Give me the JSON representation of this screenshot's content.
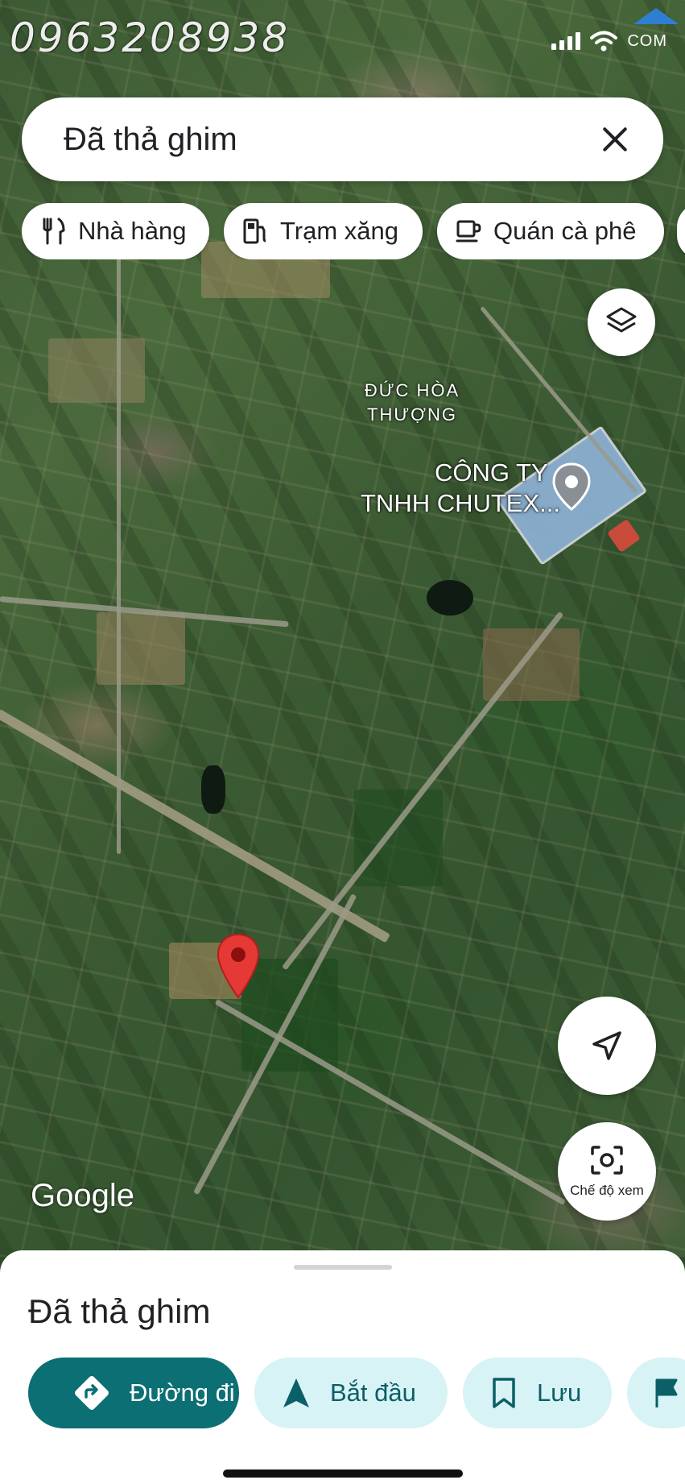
{
  "status_bar": {
    "watermark_phone": "0963208938",
    "com_badge": "COM",
    "icons": [
      "signal-icon",
      "wifi-icon"
    ]
  },
  "search": {
    "title": "Đã thả ghim",
    "close_icon": "close-icon"
  },
  "chips": [
    {
      "label": "Nhà hàng",
      "icon": "restaurant-icon"
    },
    {
      "label": "Trạm xăng",
      "icon": "gas-station-icon"
    },
    {
      "label": "Quán cà phê",
      "icon": "coffee-icon"
    }
  ],
  "map": {
    "place_label": [
      "ĐỨC HÒA",
      "THƯỢNG"
    ],
    "company_label": [
      "CÔNG TY",
      "TNHH CHUTEX..."
    ],
    "google_logo": "Google",
    "view_mode_label": "Chế độ xem"
  },
  "sheet": {
    "title": "Đã thả ghim",
    "actions": [
      {
        "label": "Đường đi",
        "icon": "directions-icon",
        "style": "primary"
      },
      {
        "label": "Bắt đầu",
        "icon": "navigation-arrow-icon",
        "style": "secondary"
      },
      {
        "label": "Lưu",
        "icon": "bookmark-icon",
        "style": "secondary"
      },
      {
        "label": "",
        "icon": "flag-icon",
        "style": "secondary"
      }
    ]
  },
  "colors": {
    "primary": "#0b6f74",
    "secondary_bg": "#d8f3f6",
    "pin": "#e53935"
  }
}
